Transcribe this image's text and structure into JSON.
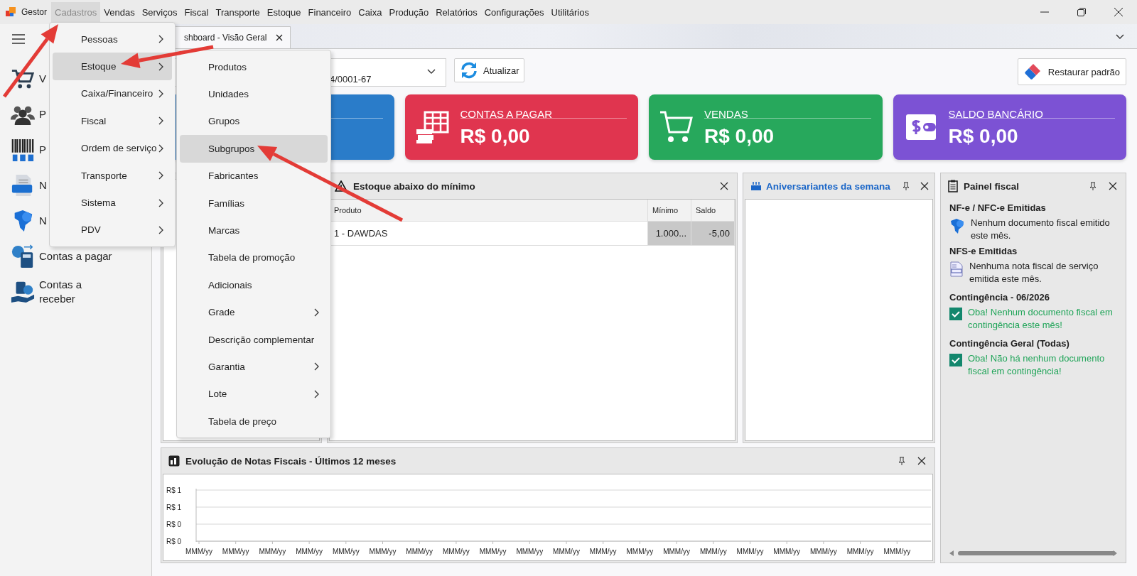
{
  "app_name": "Gestor",
  "menu_bar": {
    "items": [
      {
        "label": "Cadastros",
        "selected": true
      },
      {
        "label": "Vendas",
        "selected": false
      },
      {
        "label": "Serviços",
        "selected": false
      },
      {
        "label": "Fiscal",
        "selected": false
      },
      {
        "label": "Transporte",
        "selected": false
      },
      {
        "label": "Estoque",
        "selected": false
      },
      {
        "label": "Financeiro",
        "selected": false
      },
      {
        "label": "Caixa",
        "selected": false
      },
      {
        "label": "Produção",
        "selected": false
      },
      {
        "label": "Relatórios",
        "selected": false
      },
      {
        "label": "Configurações",
        "selected": false
      },
      {
        "label": "Utilitários",
        "selected": false
      }
    ]
  },
  "sidebar": {
    "items": [
      {
        "kind": "cart",
        "label": "V"
      },
      {
        "kind": "people",
        "label": "P"
      },
      {
        "kind": "barcode",
        "label": "P"
      },
      {
        "kind": "nfse",
        "label": "N"
      },
      {
        "kind": "nfe",
        "label": "N"
      },
      {
        "kind": "payable",
        "label": "Contas a pagar"
      },
      {
        "kind": "receivable",
        "label": "Contas a receber"
      }
    ]
  },
  "tab": {
    "label": "shboard - Visão Geral"
  },
  "toolbar": {
    "company_value": "4/0001-67",
    "refresh_button": "Atualizar",
    "restore_button": "Restaurar padrão"
  },
  "cards": [
    {
      "color": "#2a7cc9"
    },
    {
      "kind": "payable",
      "color": "#e0354f",
      "label": "CONTAS A PAGAR",
      "value": "R$ 0,00"
    },
    {
      "kind": "sales",
      "color": "#27a85c",
      "label": "VENDAS",
      "value": "R$ 0,00"
    },
    {
      "kind": "bank",
      "color": "#7c52d4",
      "label": "SALDO BANCÁRIO",
      "value": "R$ 0,00"
    }
  ],
  "stock_panel": {
    "title": "Estoque abaixo do mínimo",
    "pinnable": false,
    "columns": [
      "Produto",
      "Mínimo",
      "Saldo"
    ],
    "rows": [
      [
        "1 - DAWDAS",
        "1.000...",
        "-5,00"
      ]
    ]
  },
  "birthday_panel": {
    "title": "Aniversariantes da semana",
    "pinnable": true
  },
  "fiscal_panel": {
    "title": "Painel fiscal",
    "pinnable": true,
    "sections": [
      {
        "kind": "nfe",
        "heading": "NF-e / NFC-e Emitidas",
        "text": "Nenhum documento fiscal emitido este mês."
      },
      {
        "kind": "nfse",
        "heading": "NFS-e Emitidas",
        "text": "Nenhuma nota fiscal de serviço emitida este mês."
      },
      {
        "kind": "ok",
        "heading": "Contingência - 06/2026",
        "text": "Oba! Nenhum documento fiscal em contingência este mês!"
      },
      {
        "kind": "ok",
        "heading": "Contingência Geral (Todas)",
        "text": "Oba! Não há nenhum documento fiscal em contingência!"
      }
    ]
  },
  "chart_panel": {
    "title": "Evolução de Notas Fiscais - Últimos 12 meses",
    "pinnable": true,
    "chart_data": {
      "type": "other",
      "categories": [
        "MMM/yy",
        "MMM/yy",
        "MMM/yy",
        "MMM/yy",
        "MMM/yy",
        "MMM/yy",
        "MMM/yy",
        "MMM/yy",
        "MMM/yy",
        "MMM/yy",
        "MMM/yy",
        "MMM/yy",
        "MMM/yy",
        "MMM/yy",
        "MMM/yy",
        "MMM/yy",
        "MMM/yy",
        "MMM/yy",
        "MMM/yy",
        "MMM/yy"
      ],
      "yticks": [
        {
          "label": "R$ 0"
        },
        {
          "label": "R$ 0"
        },
        {
          "label": "R$ 1"
        },
        {
          "label": "R$ 1"
        }
      ]
    }
  },
  "cadastros_menu": {
    "items": [
      {
        "label": "Pessoas",
        "selected": false,
        "submenu": true
      },
      {
        "label": "Estoque",
        "selected": true,
        "submenu": true
      },
      {
        "label": "Caixa/Financeiro",
        "selected": false,
        "submenu": true
      },
      {
        "label": "Fiscal",
        "selected": false,
        "submenu": true
      },
      {
        "label": "Ordem de serviço",
        "selected": false,
        "submenu": true
      },
      {
        "label": "Transporte",
        "selected": false,
        "submenu": true
      },
      {
        "label": "Sistema",
        "selected": false,
        "submenu": true
      },
      {
        "label": "PDV",
        "selected": false,
        "submenu": true
      }
    ]
  },
  "estoque_submenu": {
    "items": [
      {
        "label": "Produtos",
        "selected": false,
        "submenu": false
      },
      {
        "label": "Unidades",
        "selected": false,
        "submenu": false
      },
      {
        "label": "Grupos",
        "selected": false,
        "submenu": false
      },
      {
        "label": "Subgrupos",
        "selected": true,
        "submenu": false
      },
      {
        "label": "Fabricantes",
        "selected": false,
        "submenu": false
      },
      {
        "label": "Famílias",
        "selected": false,
        "submenu": false
      },
      {
        "label": "Marcas",
        "selected": false,
        "submenu": false
      },
      {
        "label": "Tabela de promoção",
        "selected": false,
        "submenu": false
      },
      {
        "label": "Adicionais",
        "selected": false,
        "submenu": false
      },
      {
        "label": "Grade",
        "selected": false,
        "submenu": true
      },
      {
        "label": "Descrição complementar",
        "selected": false,
        "submenu": false
      },
      {
        "label": "Garantia",
        "selected": false,
        "submenu": true
      },
      {
        "label": "Lote",
        "selected": false,
        "submenu": true
      },
      {
        "label": "Tabela de preço",
        "selected": false,
        "submenu": false
      }
    ]
  }
}
